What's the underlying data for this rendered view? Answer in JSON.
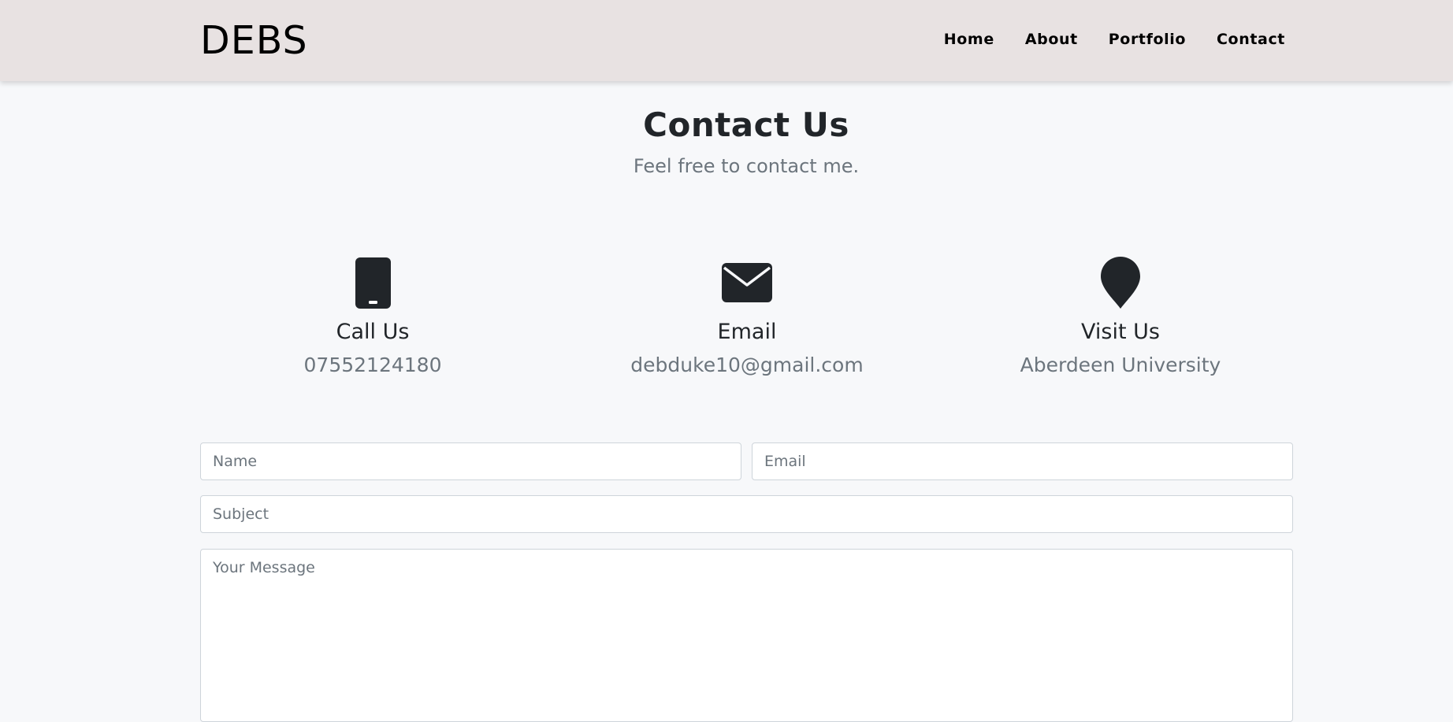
{
  "navbar": {
    "brand": "DEBS",
    "links": [
      {
        "label": "Home"
      },
      {
        "label": "About"
      },
      {
        "label": "Portfolio"
      },
      {
        "label": "Contact"
      }
    ]
  },
  "header": {
    "title": "Contact Us",
    "subtitle": "Feel free to contact me."
  },
  "contact_info": [
    {
      "icon": "phone-icon",
      "title": "Call Us",
      "value": "07552124180"
    },
    {
      "icon": "envelope-icon",
      "title": "Email",
      "value": "debduke10@gmail.com"
    },
    {
      "icon": "map-pin-icon",
      "title": "Visit Us",
      "value": "Aberdeen University"
    }
  ],
  "form": {
    "name_placeholder": "Name",
    "email_placeholder": "Email",
    "subject_placeholder": "Subject",
    "message_placeholder": "Your Message"
  },
  "colors": {
    "navbar_bg": "#e8e2e2",
    "page_bg": "#f7f8fa",
    "muted_text": "#6c757d",
    "icon": "#212529"
  }
}
